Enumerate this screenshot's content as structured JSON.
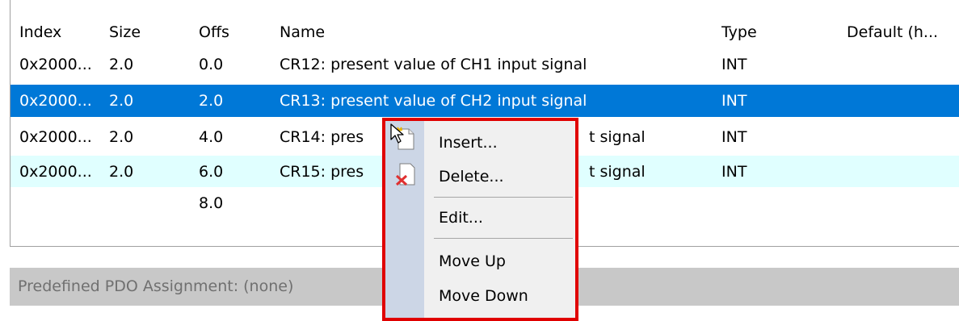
{
  "table": {
    "columns": [
      "Index",
      "Size",
      "Offs",
      "Name",
      "Type",
      "Default (h..."
    ],
    "rows": [
      {
        "index": "0x2000...",
        "size": "2.0",
        "offs": "0.0",
        "name": "CR12: present value of CH1 input signal",
        "type": "INT",
        "state": "normal"
      },
      {
        "index": "0x2000...",
        "size": "2.0",
        "offs": "2.0",
        "name": "CR13: present value of CH2 input signal",
        "type": "INT",
        "state": "selected"
      },
      {
        "index": "0x2000...",
        "size": "2.0",
        "offs": "4.0",
        "name_left": "CR14: pres",
        "name_right": "t signal",
        "type": "INT",
        "state": "normal"
      },
      {
        "index": "0x2000...",
        "size": "2.0",
        "offs": "6.0",
        "name_left": "CR15: pres",
        "name_right": "t signal",
        "type": "INT",
        "state": "highlighted"
      },
      {
        "offs": "8.0"
      }
    ]
  },
  "assignment": {
    "label": "Predefined PDO Assignment: (none)"
  },
  "context_menu": {
    "items": [
      "Insert...",
      "Delete...",
      "Edit...",
      "Move Up",
      "Move Down"
    ],
    "icons": [
      "insert-icon",
      "delete-icon"
    ]
  },
  "colors": {
    "selection": "#0078d7",
    "row_highlight": "#e0ffff",
    "menu_outline": "#e00000"
  }
}
